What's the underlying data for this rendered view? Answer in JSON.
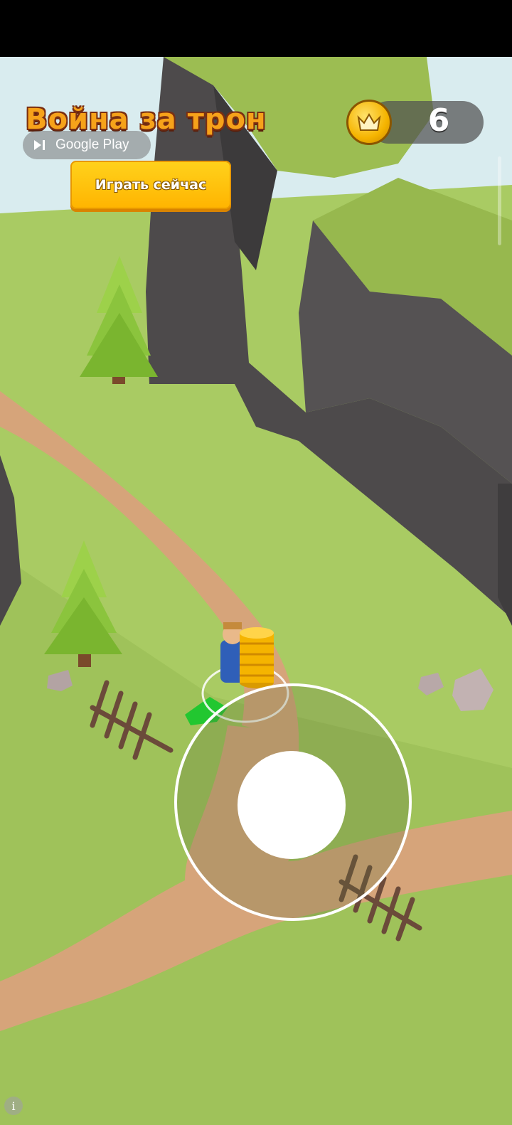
{
  "ad": {
    "game_title": "Война за трон",
    "store_label": "Google Play",
    "cta_label": "Играть сейчас"
  },
  "hud": {
    "crown_count": "6"
  },
  "icons": {
    "store": "play-store-icon",
    "crown": "crown-icon",
    "info": "info-icon"
  },
  "colors": {
    "grass": "#a9cb63",
    "path": "#d6a47a",
    "rock": "#4a4849",
    "cta": "#ffc21a",
    "coin": "#f5b400"
  }
}
